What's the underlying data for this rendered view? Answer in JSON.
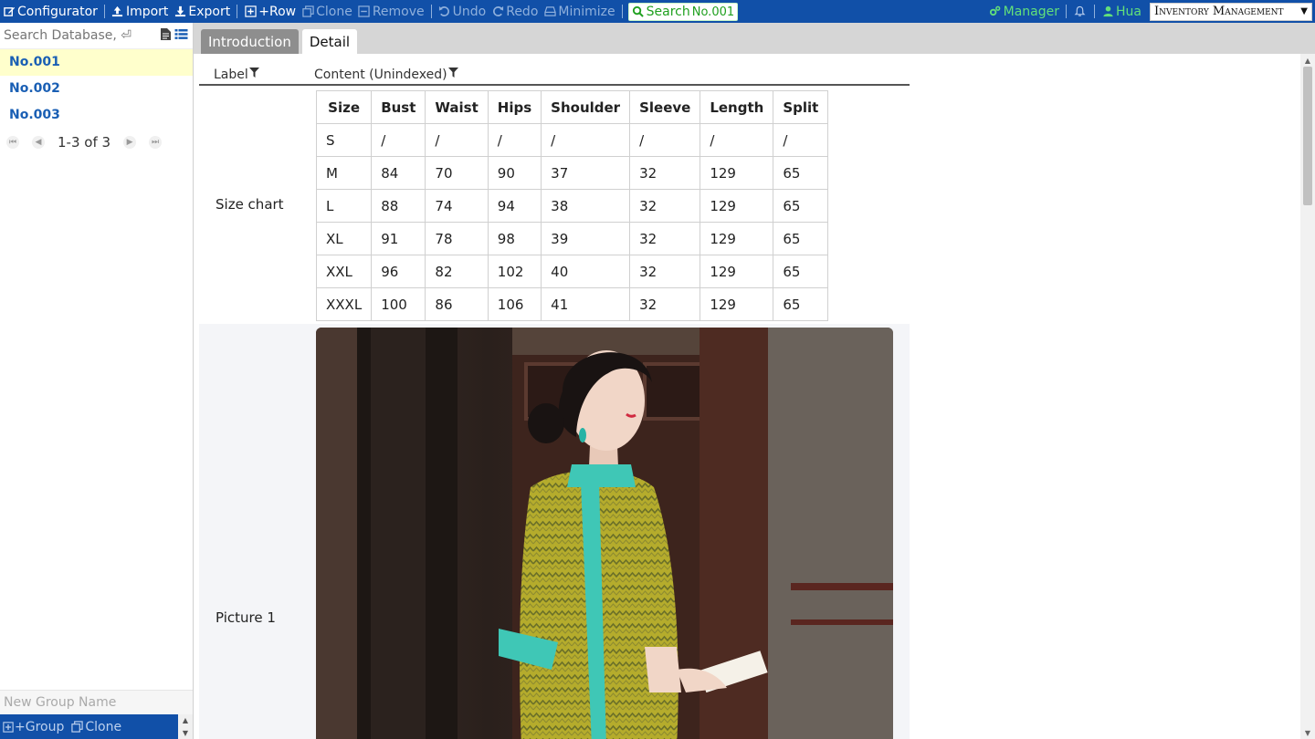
{
  "toolbar": {
    "configurator": "Configurator",
    "import": "Import",
    "export": "Export",
    "add_row": "+Row",
    "clone": "Clone",
    "remove": "Remove",
    "undo": "Undo",
    "redo": "Redo",
    "minimize": "Minimize",
    "search": "Search",
    "search_badge": "No.001",
    "manager": "Manager",
    "user": "Hua",
    "app_select": "Inventory Management"
  },
  "sidebar": {
    "search_placeholder": "Search Database, ⏎",
    "records": [
      "No.001",
      "No.002",
      "No.003"
    ],
    "pager": "1-3 of 3",
    "group_placeholder": "New Group Name",
    "add_group": "+Group",
    "clone_group": "Clone"
  },
  "tabs": [
    {
      "label": "Introduction",
      "active": false
    },
    {
      "label": "Detail",
      "active": true
    }
  ],
  "detail": {
    "col_label": "Label",
    "col_content": "Content (Unindexed)",
    "size_chart_label": "Size chart",
    "picture_label": "Picture 1",
    "size_table": {
      "headers": [
        "Size",
        "Bust",
        "Waist",
        "Hips",
        "Shoulder",
        "Sleeve",
        "Length",
        "Split"
      ],
      "rows": [
        [
          "S",
          "/",
          "/",
          "/",
          "/",
          "/",
          "/",
          "/"
        ],
        [
          "M",
          "84",
          "70",
          "90",
          "37",
          "32",
          "129",
          "65"
        ],
        [
          "L",
          "88",
          "74",
          "94",
          "38",
          "32",
          "129",
          "65"
        ],
        [
          "XL",
          "91",
          "78",
          "98",
          "39",
          "32",
          "129",
          "65"
        ],
        [
          "XXL",
          "96",
          "82",
          "102",
          "40",
          "32",
          "129",
          "65"
        ],
        [
          "XXXL",
          "100",
          "86",
          "106",
          "41",
          "32",
          "129",
          "65"
        ]
      ]
    }
  },
  "colors": {
    "toolbar_bg": "#1150a8",
    "accent_green": "#62e07a",
    "selected_row": "#ffffcc",
    "link_blue": "#1a5fb4"
  }
}
